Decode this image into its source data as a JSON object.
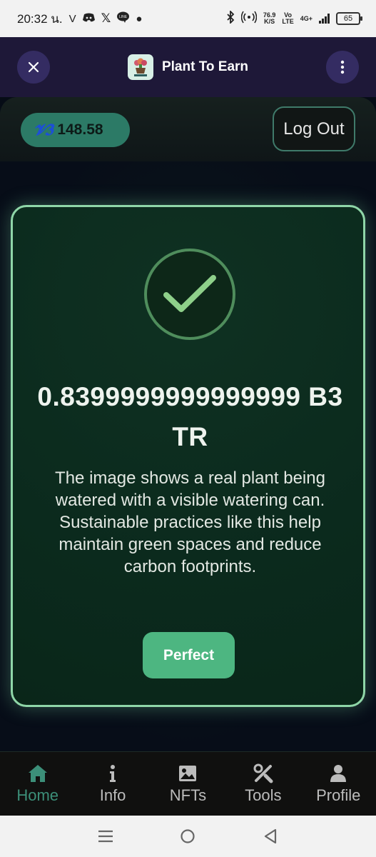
{
  "status_bar": {
    "time": "20:32 น.",
    "net_speed": "76.9",
    "net_speed_unit": "K/S",
    "vo_label": "Vo",
    "lte_label": "LTE",
    "network": "4G+",
    "battery": "65"
  },
  "header": {
    "title": "Plant To Earn",
    "logo_icon": "plant-to-earn-logo"
  },
  "account": {
    "balance": "148.58",
    "logout_label": "Log Out"
  },
  "result": {
    "amount": "0.8399999999999999 B3TR",
    "description": "The image shows a real plant being watered with a visible watering can. Sustainable practices like this help maintain green spaces and reduce carbon footprints.",
    "button_label": "Perfect"
  },
  "nav": {
    "items": [
      {
        "label": "Home",
        "icon": "home-icon",
        "active": true
      },
      {
        "label": "Info",
        "icon": "info-icon",
        "active": false
      },
      {
        "label": "NFTs",
        "icon": "image-icon",
        "active": false
      },
      {
        "label": "Tools",
        "icon": "tools-icon",
        "active": false
      },
      {
        "label": "Profile",
        "icon": "profile-icon",
        "active": false
      }
    ]
  },
  "colors": {
    "accent": "#4db681",
    "card_border": "#8fd6a8",
    "header_bg": "#1e1838",
    "active_nav": "#3c8f79"
  }
}
